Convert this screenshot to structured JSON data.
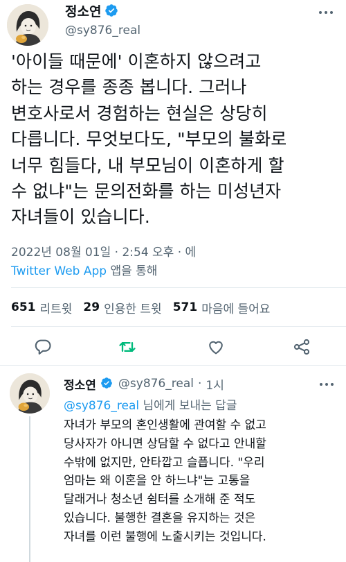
{
  "main_tweet": {
    "author_name": "정소연",
    "author_handle": "@sy876_real",
    "text_lines": [
      "'아이들 때문에' 이혼하지 않으려고",
      "하는 경우를 종종 봅니다. 그러나",
      "변호사로서 경험하는 현실은 상당히",
      "다릅니다. 무엇보다도, \"부모의 불화로",
      "너무 힘들다, 내 부모님이 이혼하게 할",
      "수 없냐\"는 문의전화를 하는 미성년자",
      "자녀들이 있습니다."
    ],
    "timestamp": "2022년 08월 01일 · 2:54 오후 · 에",
    "source_app": "Twitter Web App",
    "source_suffix": " 앱을 통해",
    "stats": {
      "retweets_count": "651",
      "retweets_label": "리트윗",
      "quotes_count": "29",
      "quotes_label": "인용한 트윗",
      "likes_count": "571",
      "likes_label": "마음에 들어요"
    }
  },
  "reply_tweet": {
    "author_name": "정소연",
    "author_handle": "@sy876_real",
    "separator": "·",
    "time": "1시",
    "reply_to_mention": "@sy876_real",
    "reply_to_suffix": " 님에게 보내는 답글",
    "text_lines": [
      "자녀가 부모의 혼인생활에 관여할 수 없고",
      "당사자가 아니면 상담할 수 없다고 안내할",
      "수밖에 없지만, 안타깝고 슬픕니다. \"우리",
      "엄마는 왜 이혼을 안 하느냐\"는 고통을",
      "달래거나 청소년 쉼터를 소개해 준 적도",
      "있습니다. 불행한 결혼을 유지하는 것은",
      "자녀를 이런 불행에 노출시키는 것입니다."
    ]
  },
  "colors": {
    "text": "#0f1419",
    "secondary": "#536471",
    "accent": "#1d9bf0",
    "retweet_green": "#00ba7c",
    "divider": "#e6ecf0"
  },
  "icons": {
    "verified": "verified-badge-icon",
    "more": "more-dots-icon",
    "reply": "reply-bubble-icon",
    "retweet": "retweet-icon",
    "like": "heart-icon",
    "share": "share-icon"
  }
}
